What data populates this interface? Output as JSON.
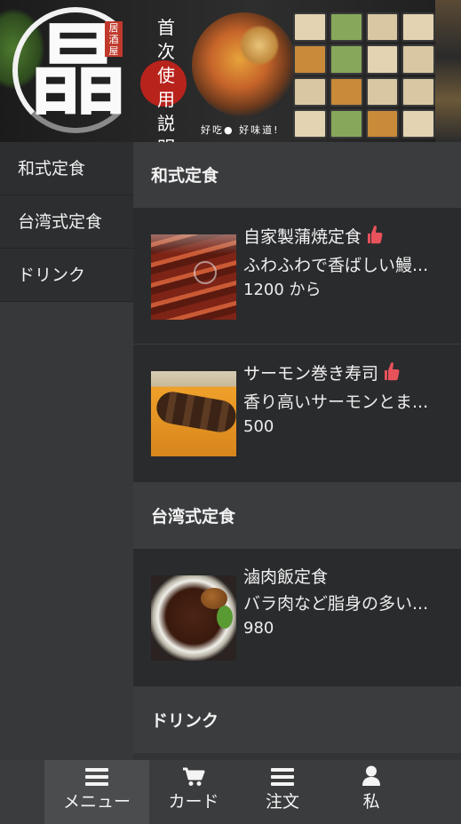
{
  "banner": {
    "logo_char": "晶",
    "seal_text": "居酒屋",
    "vertical_text": [
      "首",
      "次",
      "使",
      "用",
      "説",
      "明"
    ],
    "caption": "好吃● 好味道!"
  },
  "sidebar": {
    "items": [
      {
        "label": "和式定食"
      },
      {
        "label": "台湾式定食"
      },
      {
        "label": "ドリンク"
      }
    ]
  },
  "categories": [
    {
      "title": "和式定食",
      "items": [
        {
          "name": "自家製蒲焼定食",
          "desc": "ふわふわで香ばしい鰻...",
          "price": "1200 から",
          "image": "grilled-eel-photo",
          "recommended": true
        },
        {
          "name": "サーモン巻き寿司",
          "desc": "香り高いサーモンとま...",
          "price": "500",
          "image": "salmon-roll-photo",
          "recommended": true
        }
      ]
    },
    {
      "title": "台湾式定食",
      "items": [
        {
          "name": "滷肉飯定食",
          "desc": "バラ肉など脂身の多い...",
          "price": "980",
          "image": "braised-pork-rice-photo",
          "recommended": false
        }
      ]
    },
    {
      "title": "ドリンク",
      "items": []
    }
  ],
  "bottom_nav": {
    "tabs": [
      {
        "label": "メニュー",
        "icon": "menu-list-icon",
        "active": true
      },
      {
        "label": "カード",
        "icon": "cart-icon",
        "active": false
      },
      {
        "label": "注文",
        "icon": "order-list-icon",
        "active": false
      },
      {
        "label": "私",
        "icon": "user-icon",
        "active": false
      }
    ]
  },
  "colors": {
    "background": "#2a2b2d",
    "sidebar": "#2d2e30",
    "header": "#3b3c3e",
    "nav_active": "#4b4c4e",
    "recommend_icon": "#e8525b"
  }
}
